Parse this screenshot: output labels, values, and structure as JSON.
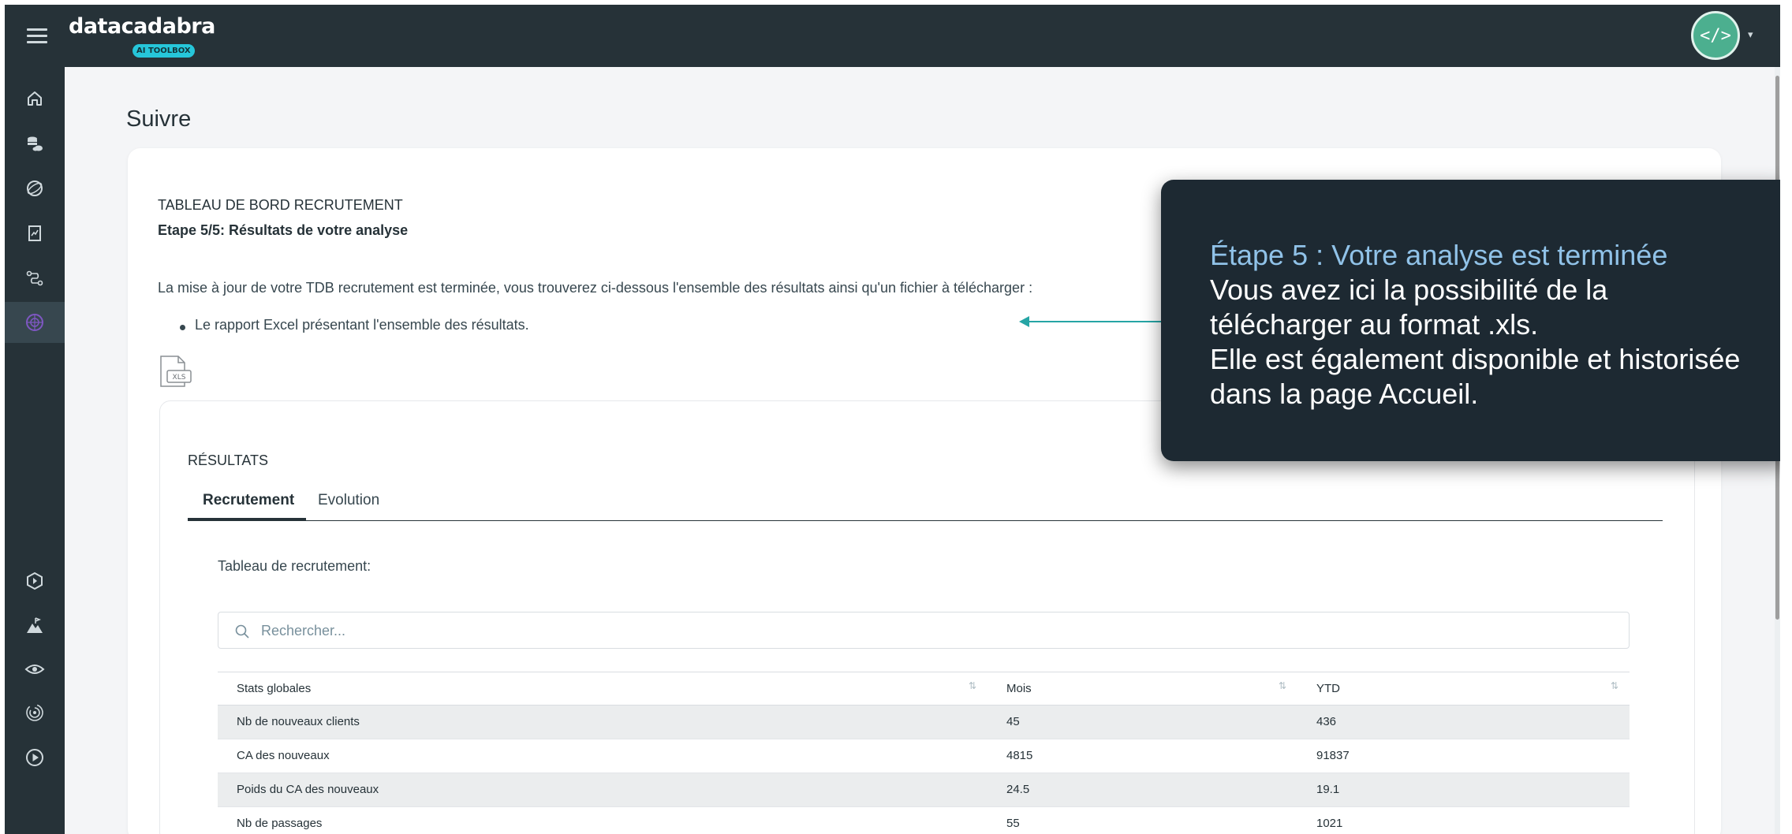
{
  "header": {
    "logo_text": "datacadabra",
    "logo_badge": "AI TOOLBOX",
    "avatar_label": "</>"
  },
  "page": {
    "title": "Suivre"
  },
  "main": {
    "dashboard_title": "TABLEAU DE BORD RECRUTEMENT",
    "step_label": "Etape 5/5: Résultats de votre analyse",
    "intro_text": "La mise à jour de votre TDB recrutement est terminée, vous trouverez ci-dessous l'ensemble des résultats ainsi qu'un fichier à télécharger :",
    "bullets": [
      "Le rapport Excel présentant l'ensemble des résultats."
    ],
    "file_icon_label": "XLS"
  },
  "results": {
    "title": "RÉSULTATS",
    "tabs": [
      {
        "label": "Recrutement",
        "active": true
      },
      {
        "label": "Evolution",
        "active": false
      }
    ],
    "table_caption": "Tableau de recrutement:",
    "search_placeholder": "Rechercher...",
    "table": {
      "headers": [
        "Stats globales",
        "Mois",
        "YTD"
      ],
      "rows": [
        [
          "Nb de nouveaux clients",
          "45",
          "436"
        ],
        [
          "CA des nouveaux",
          "4815",
          "91837"
        ],
        [
          "Poids du CA des nouveaux",
          "24.5",
          "19.1"
        ],
        [
          "Nb de passages",
          "55",
          "1021"
        ]
      ]
    }
  },
  "tooltip": {
    "title": "Étape 5 : Votre analyse est terminée",
    "lines": [
      "Vous avez ici la possibilité de la",
      "télécharger au format .xls.",
      "Elle est également disponible et historisée",
      "dans la page Accueil."
    ]
  },
  "colors": {
    "topbar": "#263238",
    "accent": "#26c6da",
    "arrow": "#26a5a5",
    "tooltip_bg": "#1d2932",
    "tooltip_title": "#90c2e8",
    "active_nav_icon": "#7e57c2"
  },
  "sidebar_icons": [
    "home-icon",
    "database-cloud-icon",
    "orbit-icon",
    "report-chart-icon",
    "route-icon",
    "target-radar-icon",
    "hexagon-play-icon",
    "mountain-flag-icon",
    "eye-icon",
    "fingerprint-icon",
    "play-circle-icon"
  ]
}
